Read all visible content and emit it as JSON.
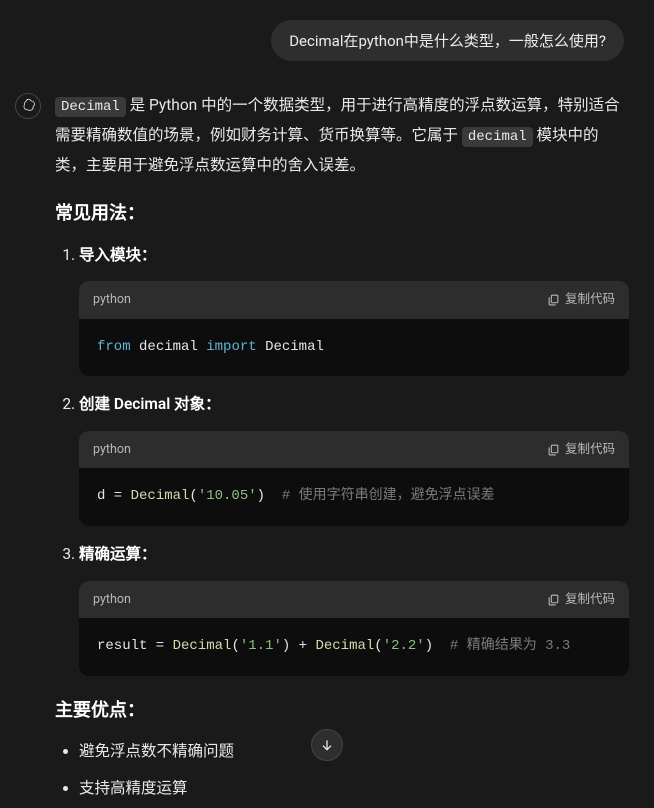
{
  "user_message": "Decimal在python中是什么类型，一般怎么使用?",
  "intro": {
    "code1": "Decimal",
    "part1": " 是 Python 中的一个数据类型，用于进行高精度的浮点数运算，特别适合需要精确数值的场景，例如财务计算、货币换算等。它属于 ",
    "code2": "decimal",
    "part2": " 模块中的类，主要用于避免浮点数运算中的舍入误差。"
  },
  "section_usage": "常见用法：",
  "items": [
    {
      "label": "导入模块："
    },
    {
      "label": "创建 Decimal 对象："
    },
    {
      "label": "精确运算："
    }
  ],
  "code_lang": "python",
  "copy_label": "复制代码",
  "code1": {
    "kw1": "from",
    "mod": "decimal",
    "kw2": "import",
    "cls": "Decimal"
  },
  "code2": {
    "var": "d = ",
    "fn": "Decimal",
    "p1": "(",
    "str": "'10.05'",
    "p2": ")",
    "cmt": "  # 使用字符串创建，避免浮点误差"
  },
  "code3": {
    "var": "result = ",
    "fn1": "Decimal",
    "p1": "(",
    "s1": "'1.1'",
    "p2": ") + ",
    "fn2": "Decimal",
    "p3": "(",
    "s2": "'2.2'",
    "p4": ")",
    "cmt": "  # 精确结果为 3.3"
  },
  "section_adv": "主要优点：",
  "advantages": [
    "避免浮点数不精确问题",
    "支持高精度运算"
  ]
}
